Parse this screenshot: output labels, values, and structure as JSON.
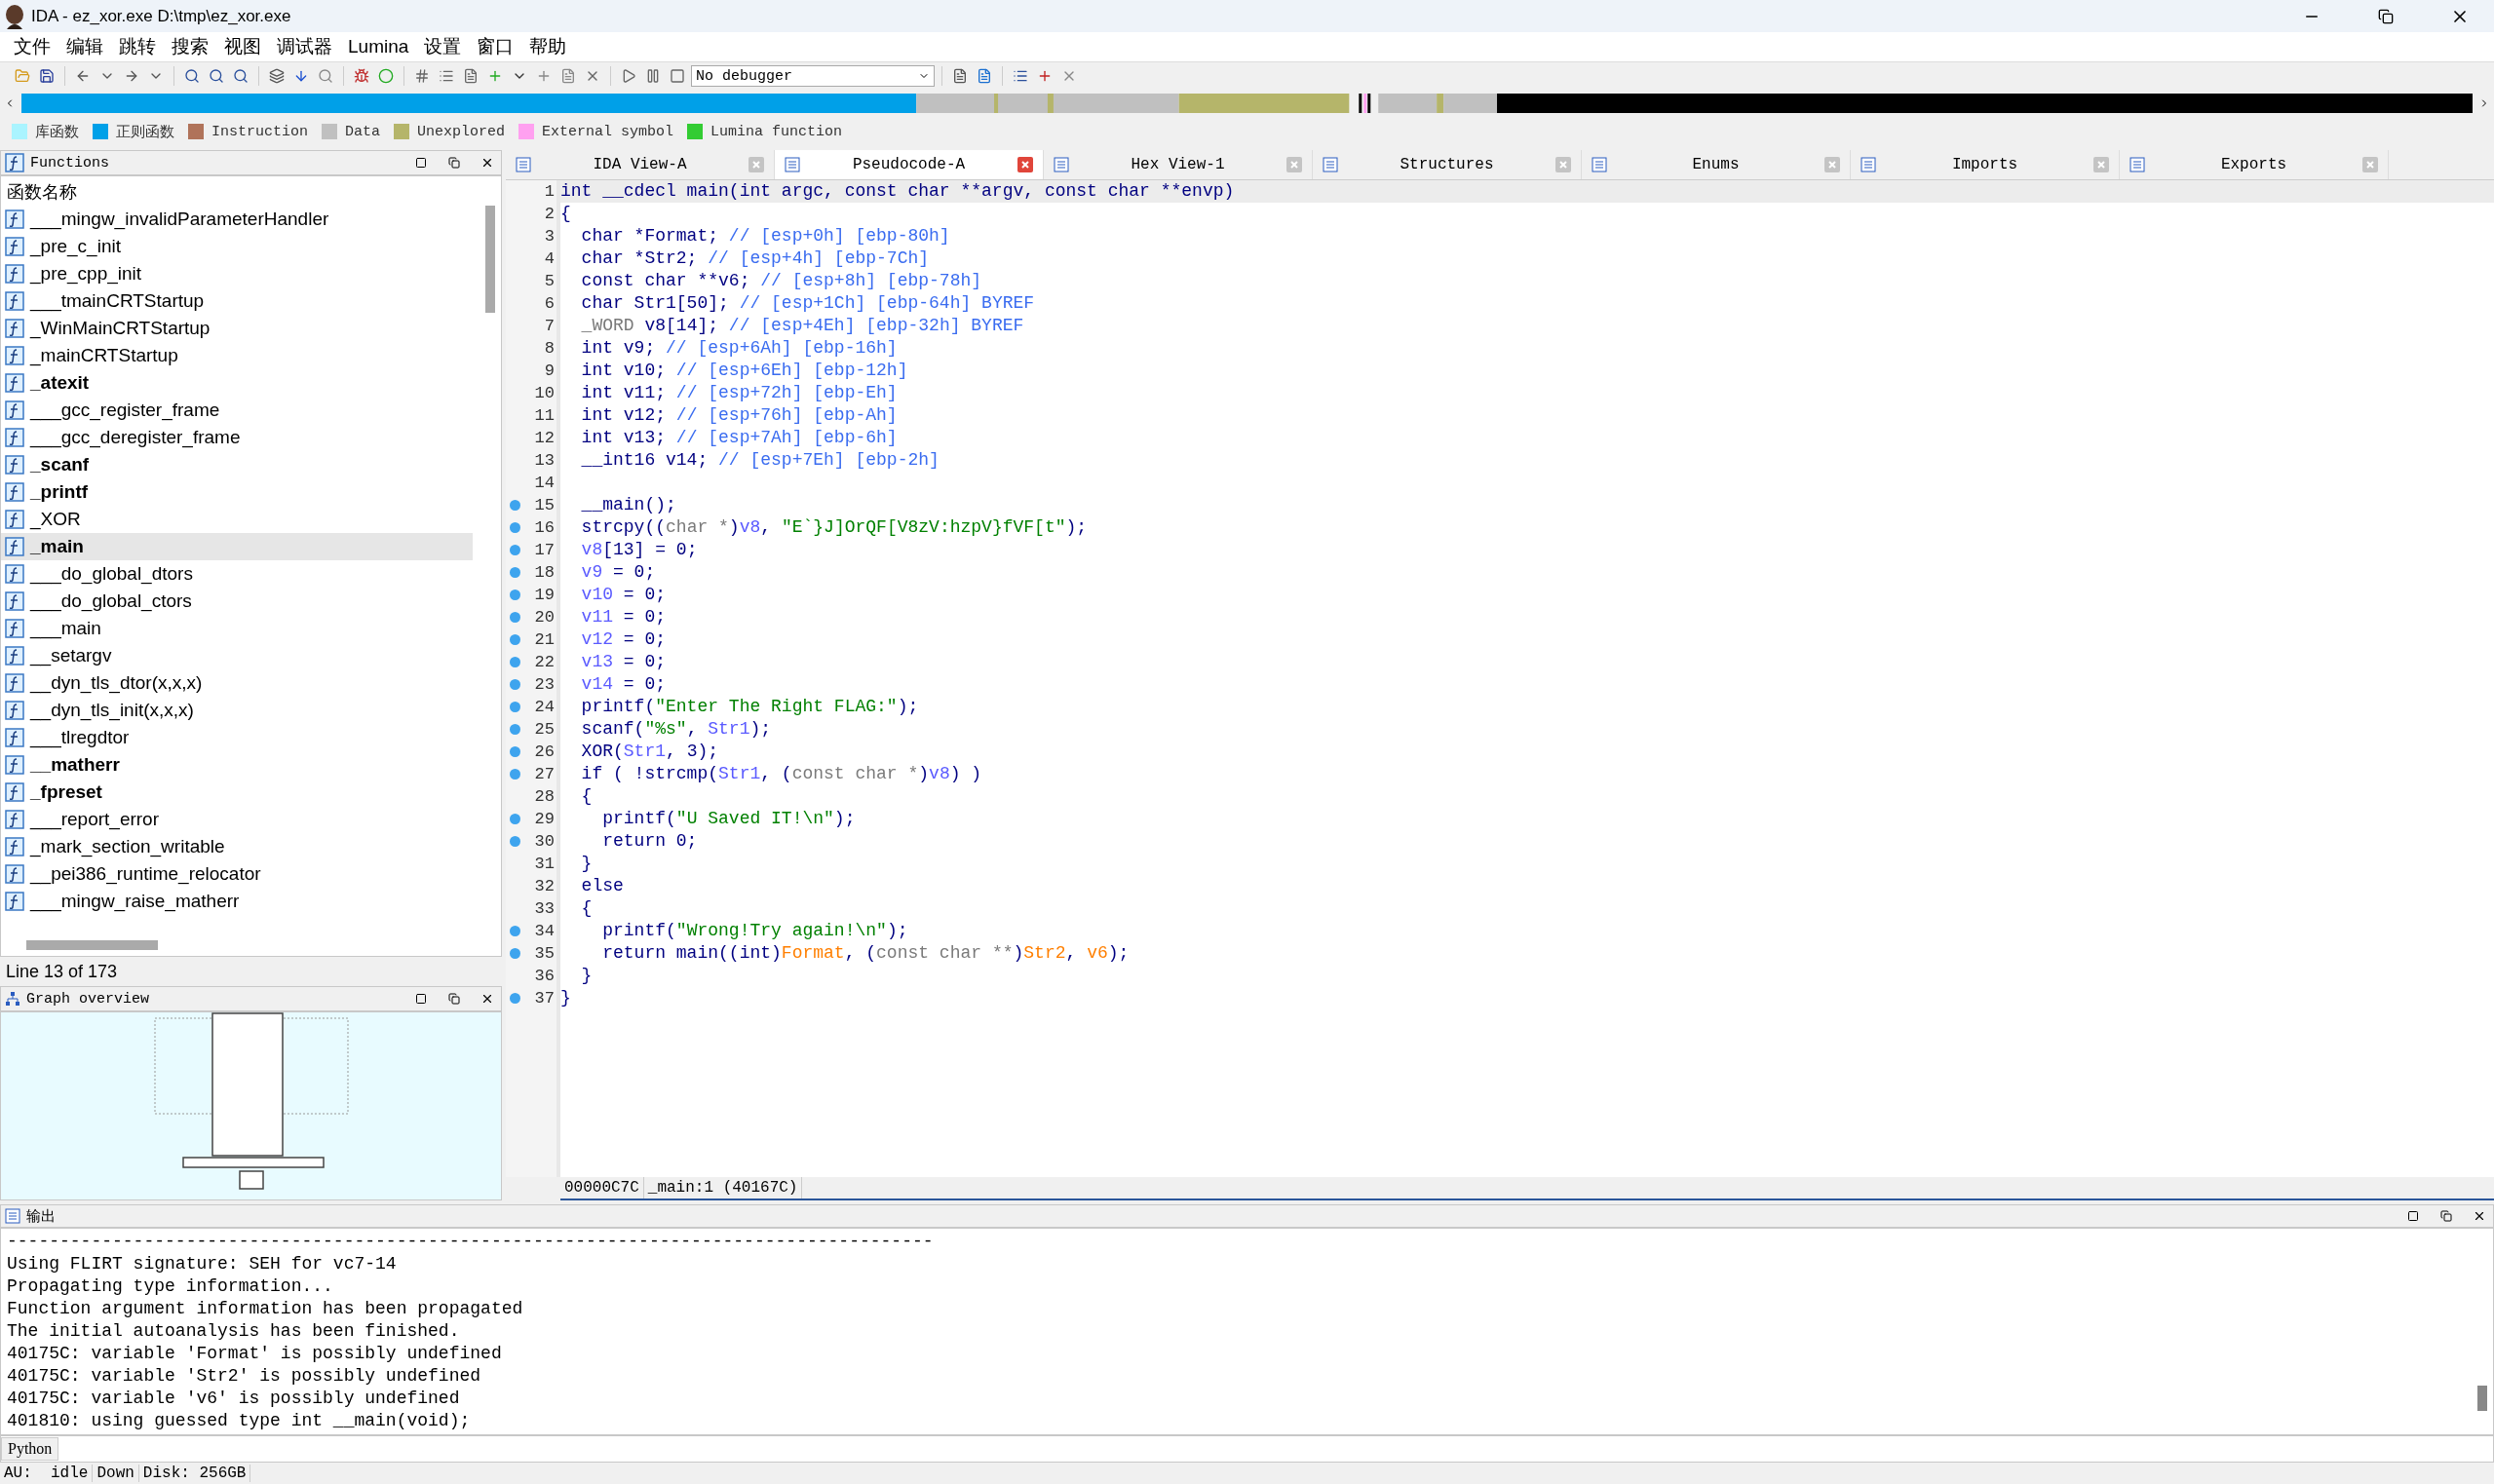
{
  "window": {
    "title": "IDA - ez_xor.exe D:\\tmp\\ez_xor.exe"
  },
  "menu": [
    "文件",
    "编辑",
    "跳转",
    "搜索",
    "视图",
    "调试器",
    "Lumina",
    "设置",
    "窗口",
    "帮助"
  ],
  "toolbar": {
    "debugger": "No debugger"
  },
  "legend": [
    {
      "label": "库函数",
      "color": "#aaf4ff"
    },
    {
      "label": "正则函数",
      "color": "#00a0e8"
    },
    {
      "label": "Instruction",
      "color": "#b0735a"
    },
    {
      "label": "Data",
      "color": "#c0c0c0"
    },
    {
      "label": "Unexplored",
      "color": "#b5b56a"
    },
    {
      "label": "External symbol",
      "color": "#ffa0f0"
    },
    {
      "label": "Lumina function",
      "color": "#33cc33"
    }
  ],
  "functions_panel": {
    "title": "Functions",
    "column": "函数名称",
    "status": "Line 13 of 173",
    "items": [
      {
        "name": "___mingw_invalidParameterHandler",
        "bold": false,
        "selected": false
      },
      {
        "name": "_pre_c_init",
        "bold": false,
        "selected": false
      },
      {
        "name": "_pre_cpp_init",
        "bold": false,
        "selected": false
      },
      {
        "name": "___tmainCRTStartup",
        "bold": false,
        "selected": false
      },
      {
        "name": "_WinMainCRTStartup",
        "bold": false,
        "selected": false
      },
      {
        "name": "_mainCRTStartup",
        "bold": false,
        "selected": false
      },
      {
        "name": "_atexit",
        "bold": true,
        "selected": false
      },
      {
        "name": "___gcc_register_frame",
        "bold": false,
        "selected": false
      },
      {
        "name": "___gcc_deregister_frame",
        "bold": false,
        "selected": false
      },
      {
        "name": "_scanf",
        "bold": true,
        "selected": false
      },
      {
        "name": "_printf",
        "bold": true,
        "selected": false
      },
      {
        "name": "_XOR",
        "bold": false,
        "selected": false
      },
      {
        "name": "_main",
        "bold": true,
        "selected": true
      },
      {
        "name": "___do_global_dtors",
        "bold": false,
        "selected": false
      },
      {
        "name": "___do_global_ctors",
        "bold": false,
        "selected": false
      },
      {
        "name": "___main",
        "bold": false,
        "selected": false
      },
      {
        "name": "__setargv",
        "bold": false,
        "selected": false
      },
      {
        "name": "__dyn_tls_dtor(x,x,x)",
        "bold": false,
        "selected": false
      },
      {
        "name": "__dyn_tls_init(x,x,x)",
        "bold": false,
        "selected": false
      },
      {
        "name": "___tlregdtor",
        "bold": false,
        "selected": false
      },
      {
        "name": "__matherr",
        "bold": true,
        "selected": false
      },
      {
        "name": "_fpreset",
        "bold": true,
        "selected": false
      },
      {
        "name": "___report_error",
        "bold": false,
        "selected": false
      },
      {
        "name": "_mark_section_writable",
        "bold": false,
        "selected": false
      },
      {
        "name": "__pei386_runtime_relocator",
        "bold": false,
        "selected": false
      },
      {
        "name": "___mingw_raise_matherr",
        "bold": false,
        "selected": false
      }
    ]
  },
  "graph_overview": {
    "title": "Graph overview"
  },
  "tabs": [
    {
      "label": "IDA View-A",
      "selected": false
    },
    {
      "label": "Pseudocode-A",
      "selected": true
    },
    {
      "label": "Hex View-1",
      "selected": false
    },
    {
      "label": "Structures",
      "selected": false
    },
    {
      "label": "Enums",
      "selected": false
    },
    {
      "label": "Imports",
      "selected": false
    },
    {
      "label": "Exports",
      "selected": false
    }
  ],
  "pseudocode": {
    "status_address": "00000C7C",
    "status_location": "_main:1 (40167C)",
    "lines": [
      {
        "number": "1",
        "marker": false,
        "current": true,
        "tokens": [
          {
            "kind": "code",
            "text": "int __cdecl main(int argc, const char **argv, const char **envp)"
          }
        ]
      },
      {
        "number": "2",
        "marker": false,
        "current": false,
        "tokens": [
          {
            "kind": "code",
            "text": "{"
          }
        ]
      },
      {
        "number": "3",
        "marker": false,
        "current": false,
        "tokens": [
          {
            "kind": "code",
            "text": "  char *Format; "
          },
          {
            "kind": "comment",
            "text": "// [esp+0h] [ebp-80h]"
          }
        ]
      },
      {
        "number": "4",
        "marker": false,
        "current": false,
        "tokens": [
          {
            "kind": "code",
            "text": "  char *Str2; "
          },
          {
            "kind": "comment",
            "text": "// [esp+4h] [ebp-7Ch]"
          }
        ]
      },
      {
        "number": "5",
        "marker": false,
        "current": false,
        "tokens": [
          {
            "kind": "code",
            "text": "  const char **v6; "
          },
          {
            "kind": "comment",
            "text": "// [esp+8h] [ebp-78h]"
          }
        ]
      },
      {
        "number": "6",
        "marker": false,
        "current": false,
        "tokens": [
          {
            "kind": "code",
            "text": "  char Str1[50]; "
          },
          {
            "kind": "comment",
            "text": "// [esp+1Ch] [ebp-64h] BYREF"
          }
        ]
      },
      {
        "number": "7",
        "marker": false,
        "current": false,
        "tokens": [
          {
            "kind": "cast",
            "text": "  _WORD"
          },
          {
            "kind": "code",
            "text": " v8[14]; "
          },
          {
            "kind": "comment",
            "text": "// [esp+4Eh] [ebp-32h] BYREF"
          }
        ]
      },
      {
        "number": "8",
        "marker": false,
        "current": false,
        "tokens": [
          {
            "kind": "code",
            "text": "  int v9; "
          },
          {
            "kind": "comment",
            "text": "// [esp+6Ah] [ebp-16h]"
          }
        ]
      },
      {
        "number": "9",
        "marker": false,
        "current": false,
        "tokens": [
          {
            "kind": "code",
            "text": "  int v10; "
          },
          {
            "kind": "comment",
            "text": "// [esp+6Eh] [ebp-12h]"
          }
        ]
      },
      {
        "number": "10",
        "marker": false,
        "current": false,
        "tokens": [
          {
            "kind": "code",
            "text": "  int v11; "
          },
          {
            "kind": "comment",
            "text": "// [esp+72h] [ebp-Eh]"
          }
        ]
      },
      {
        "number": "11",
        "marker": false,
        "current": false,
        "tokens": [
          {
            "kind": "code",
            "text": "  int v12; "
          },
          {
            "kind": "comment",
            "text": "// [esp+76h] [ebp-Ah]"
          }
        ]
      },
      {
        "number": "12",
        "marker": false,
        "current": false,
        "tokens": [
          {
            "kind": "code",
            "text": "  int v13; "
          },
          {
            "kind": "comment",
            "text": "// [esp+7Ah] [ebp-6h]"
          }
        ]
      },
      {
        "number": "13",
        "marker": false,
        "current": false,
        "tokens": [
          {
            "kind": "code",
            "text": "  __int16 v14; "
          },
          {
            "kind": "comment",
            "text": "// [esp+7Eh] [ebp-2h]"
          }
        ]
      },
      {
        "number": "14",
        "marker": false
      },
      {
        "number": "15",
        "marker": true,
        "current": false,
        "tokens": [
          {
            "kind": "code",
            "text": "  __main();"
          }
        ]
      },
      {
        "number": "16",
        "marker": true,
        "current": false,
        "tokens": [
          {
            "kind": "code",
            "text": "  strcpy(("
          },
          {
            "kind": "cast",
            "text": "char *"
          },
          {
            "kind": "code",
            "text": ")"
          },
          {
            "kind": "var",
            "text": "v8"
          },
          {
            "kind": "code",
            "text": ", "
          },
          {
            "kind": "string",
            "text": "\"E`}J]OrQF[V8zV:hzpV}fVF[t\""
          },
          {
            "kind": "code",
            "text": ");"
          }
        ]
      },
      {
        "number": "17",
        "marker": true,
        "current": false,
        "tokens": [
          {
            "kind": "var",
            "text": "  v8"
          },
          {
            "kind": "code",
            "text": "[13] = 0;"
          }
        ]
      },
      {
        "number": "18",
        "marker": true,
        "current": false,
        "tokens": [
          {
            "kind": "var",
            "text": "  v9"
          },
          {
            "kind": "code",
            "text": " = 0;"
          }
        ]
      },
      {
        "number": "19",
        "marker": true,
        "current": false,
        "tokens": [
          {
            "kind": "var",
            "text": "  v10"
          },
          {
            "kind": "code",
            "text": " = 0;"
          }
        ]
      },
      {
        "number": "20",
        "marker": true,
        "current": false,
        "tokens": [
          {
            "kind": "var",
            "text": "  v11"
          },
          {
            "kind": "code",
            "text": " = 0;"
          }
        ]
      },
      {
        "number": "21",
        "marker": true,
        "current": false,
        "tokens": [
          {
            "kind": "var",
            "text": "  v12"
          },
          {
            "kind": "code",
            "text": " = 0;"
          }
        ]
      },
      {
        "number": "22",
        "marker": true,
        "current": false,
        "tokens": [
          {
            "kind": "var",
            "text": "  v13"
          },
          {
            "kind": "code",
            "text": " = 0;"
          }
        ]
      },
      {
        "number": "23",
        "marker": true,
        "current": false,
        "tokens": [
          {
            "kind": "var",
            "text": "  v14"
          },
          {
            "kind": "code",
            "text": " = 0;"
          }
        ]
      },
      {
        "number": "24",
        "marker": true,
        "current": false,
        "tokens": [
          {
            "kind": "code",
            "text": "  printf("
          },
          {
            "kind": "string",
            "text": "\"Enter The Right FLAG:\""
          },
          {
            "kind": "code",
            "text": ");"
          }
        ]
      },
      {
        "number": "25",
        "marker": true,
        "current": false,
        "tokens": [
          {
            "kind": "code",
            "text": "  scanf("
          },
          {
            "kind": "string",
            "text": "\"%s\""
          },
          {
            "kind": "code",
            "text": ", "
          },
          {
            "kind": "var",
            "text": "Str1"
          },
          {
            "kind": "code",
            "text": ");"
          }
        ]
      },
      {
        "number": "26",
        "marker": true,
        "current": false,
        "tokens": [
          {
            "kind": "code",
            "text": "  XOR("
          },
          {
            "kind": "var",
            "text": "Str1"
          },
          {
            "kind": "code",
            "text": ", 3);"
          }
        ]
      },
      {
        "number": "27",
        "marker": true,
        "current": false,
        "tokens": [
          {
            "kind": "code",
            "text": "  if ( !strcmp("
          },
          {
            "kind": "var",
            "text": "Str1"
          },
          {
            "kind": "code",
            "text": ", ("
          },
          {
            "kind": "cast",
            "text": "const char *"
          },
          {
            "kind": "code",
            "text": ")"
          },
          {
            "kind": "var",
            "text": "v8"
          },
          {
            "kind": "code",
            "text": ") )"
          }
        ]
      },
      {
        "number": "28",
        "marker": false,
        "current": false,
        "tokens": [
          {
            "kind": "code",
            "text": "  {"
          }
        ]
      },
      {
        "number": "29",
        "marker": true,
        "current": false,
        "tokens": [
          {
            "kind": "code",
            "text": "    printf("
          },
          {
            "kind": "string",
            "text": "\"U Saved IT!\\n\""
          },
          {
            "kind": "code",
            "text": ");"
          }
        ]
      },
      {
        "number": "30",
        "marker": true,
        "current": false,
        "tokens": [
          {
            "kind": "code",
            "text": "    return 0;"
          }
        ]
      },
      {
        "number": "31",
        "marker": false,
        "current": false,
        "tokens": [
          {
            "kind": "code",
            "text": "  }"
          }
        ]
      },
      {
        "number": "32",
        "marker": false,
        "current": false,
        "tokens": [
          {
            "kind": "code",
            "text": "  else"
          }
        ]
      },
      {
        "number": "33",
        "marker": false,
        "current": false,
        "tokens": [
          {
            "kind": "code",
            "text": "  {"
          }
        ]
      },
      {
        "number": "34",
        "marker": true,
        "current": false,
        "tokens": [
          {
            "kind": "code",
            "text": "    printf("
          },
          {
            "kind": "string",
            "text": "\"Wrong!Try again!\\n\""
          },
          {
            "kind": "code",
            "text": ");"
          }
        ]
      },
      {
        "number": "35",
        "marker": true,
        "current": false,
        "tokens": [
          {
            "kind": "code",
            "text": "    return main((int)"
          },
          {
            "kind": "arg",
            "text": "Format"
          },
          {
            "kind": "code",
            "text": ", ("
          },
          {
            "kind": "cast",
            "text": "const char **"
          },
          {
            "kind": "code",
            "text": ")"
          },
          {
            "kind": "arg",
            "text": "Str2"
          },
          {
            "kind": "code",
            "text": ", "
          },
          {
            "kind": "arg",
            "text": "v6"
          },
          {
            "kind": "code",
            "text": ");"
          }
        ]
      },
      {
        "number": "36",
        "marker": false,
        "current": false,
        "tokens": [
          {
            "kind": "code",
            "text": "  }"
          }
        ]
      },
      {
        "number": "37",
        "marker": true,
        "current": false,
        "tokens": [
          {
            "kind": "code",
            "text": "}"
          }
        ]
      }
    ]
  },
  "output": {
    "title": "输出",
    "input_tab": "Python",
    "lines": [
      "----------------------------------------------------------------------------------------",
      "Using FLIRT signature: SEH for vc7-14",
      "Propagating type information...",
      "Function argument information has been propagated",
      "The initial autoanalysis has been finished.",
      "40175C: variable 'Format' is possibly undefined",
      "40175C: variable 'Str2' is possibly undefined",
      "40175C: variable 'v6' is possibly undefined",
      "401810: using guessed type int __main(void);"
    ]
  },
  "status_bar": [
    "AU:  idle",
    "Down",
    "Disk: 256GB"
  ]
}
